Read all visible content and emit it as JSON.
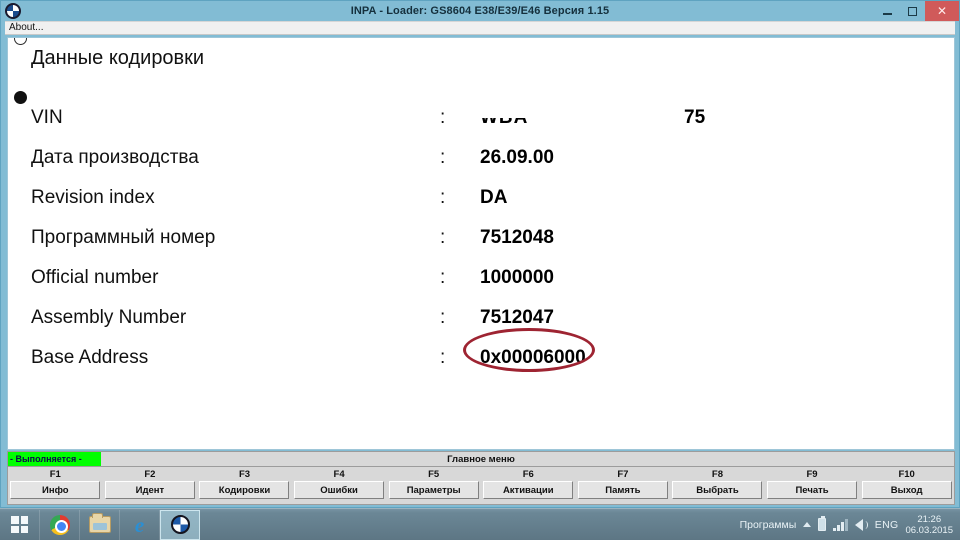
{
  "window": {
    "title": "INPA - Loader:  GS8604 E38/E39/E46 Версия 1.15",
    "app_icon": "bmw-roundel-icon",
    "controls": {
      "minimize": "minimize-icon",
      "maximize": "maximize-icon",
      "close": "✕"
    },
    "menu": {
      "about": "About..."
    }
  },
  "content": {
    "page_title": "Данные кодировки",
    "colon": ":",
    "rows": [
      {
        "label": "VIN",
        "value": "WBA",
        "value_tail": "75",
        "redacted": true
      },
      {
        "label": "Дата производства",
        "value": "26.09.00"
      },
      {
        "label": "Revision index",
        "value": "DA"
      },
      {
        "label": "Программный номер",
        "value": "7512048"
      },
      {
        "label": "Official number",
        "value": "1000000"
      },
      {
        "label": "Assembly Number",
        "value": "7512047",
        "highlighted": true
      },
      {
        "label": "Base Address",
        "value": "0x00006000"
      }
    ],
    "annotation": {
      "shape": "ellipse",
      "color": "#9e2432",
      "targets": "Assembly Number value"
    }
  },
  "status": {
    "running_label": "- Выполняется -",
    "running_color": "#00ff00",
    "menu_title": "Главное меню"
  },
  "function_keys": [
    {
      "key": "F1",
      "label": "Инфо"
    },
    {
      "key": "F2",
      "label": "Идент"
    },
    {
      "key": "F3",
      "label": "Кодировки"
    },
    {
      "key": "F4",
      "label": "Ошибки"
    },
    {
      "key": "F5",
      "label": "Параметры"
    },
    {
      "key": "F6",
      "label": "Активации"
    },
    {
      "key": "F7",
      "label": "Память"
    },
    {
      "key": "F8",
      "label": "Выбрать"
    },
    {
      "key": "F9",
      "label": "Печать"
    },
    {
      "key": "F10",
      "label": "Выход"
    }
  ],
  "taskbar": {
    "items": [
      {
        "name": "start-button",
        "icon": "windows-logo-icon",
        "active": false
      },
      {
        "name": "taskbar-chrome",
        "icon": "chrome-icon",
        "active": false
      },
      {
        "name": "taskbar-explorer",
        "icon": "folder-icon",
        "active": false
      },
      {
        "name": "taskbar-ie",
        "icon": "internet-explorer-icon",
        "active": false
      },
      {
        "name": "taskbar-inpa",
        "icon": "bmw-roundel-icon",
        "active": true
      }
    ],
    "tray": {
      "programs_label": "Программы",
      "overflow": "chevron-up-icon",
      "battery": "battery-icon",
      "signal": "signal-icon",
      "volume": "volume-icon",
      "language": "ENG",
      "time": "21:26",
      "date": "06.03.2015"
    }
  },
  "colors": {
    "titlebar": "#82bcd4",
    "close_button": "#d05a5a",
    "annotation": "#9e2432",
    "status_green": "#00ff00",
    "taskbar": "#6b8796"
  }
}
